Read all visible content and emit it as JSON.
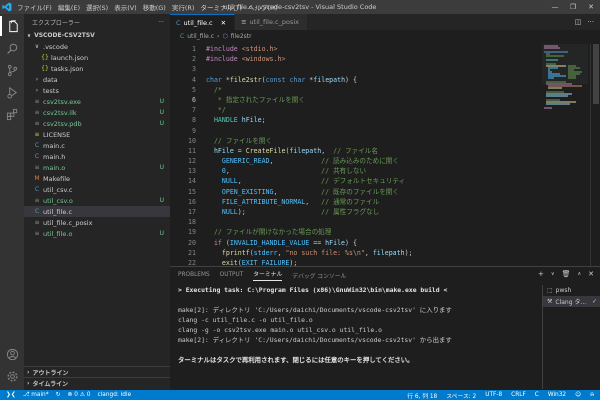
{
  "titlebar": {
    "menu": [
      "ファイル(F)",
      "編集(E)",
      "選択(S)",
      "表示(V)",
      "移動(G)",
      "実行(R)",
      "ターミナル(T)",
      "ヘルプ(H)"
    ],
    "title": "util_file.c - vscode-csv2tsv - Visual Studio Code"
  },
  "sidebar": {
    "header": "エクスプローラー",
    "more": "···",
    "folder": "VSCODE-CSV2TSV",
    "items": [
      {
        "label": ".vscode",
        "indent": 0,
        "type": "folder-open",
        "color": "#cccccc"
      },
      {
        "label": "launch.json",
        "indent": 1,
        "type": "json",
        "color": "#cccccc"
      },
      {
        "label": "tasks.json",
        "indent": 1,
        "type": "json",
        "color": "#cccccc"
      },
      {
        "label": "data",
        "indent": 0,
        "type": "folder",
        "color": "#cccccc"
      },
      {
        "label": "tests",
        "indent": 0,
        "type": "folder",
        "color": "#cccccc"
      },
      {
        "label": "csv2tsv.exe",
        "indent": 0,
        "type": "file",
        "color": "#73c991",
        "badge": "U"
      },
      {
        "label": "csv2tsv.ilk",
        "indent": 0,
        "type": "file",
        "color": "#73c991",
        "badge": "U"
      },
      {
        "label": "csv2tsv.pdb",
        "indent": 0,
        "type": "file",
        "color": "#73c991",
        "badge": "U"
      },
      {
        "label": "LICENSE",
        "indent": 0,
        "type": "license",
        "color": "#cccccc"
      },
      {
        "label": "main.c",
        "indent": 0,
        "type": "c",
        "color": "#cccccc"
      },
      {
        "label": "main.h",
        "indent": 0,
        "type": "h",
        "color": "#cccccc"
      },
      {
        "label": "main.o",
        "indent": 0,
        "type": "file",
        "color": "#73c991",
        "badge": "U"
      },
      {
        "label": "Makefile",
        "indent": 0,
        "type": "make",
        "color": "#cccccc"
      },
      {
        "label": "util_csv.c",
        "indent": 0,
        "type": "c",
        "color": "#cccccc"
      },
      {
        "label": "util_csv.o",
        "indent": 0,
        "type": "file",
        "color": "#73c991",
        "badge": "U"
      },
      {
        "label": "util_file.c",
        "indent": 0,
        "type": "c",
        "color": "#cccccc",
        "selected": true
      },
      {
        "label": "util_file.c_posix",
        "indent": 0,
        "type": "file",
        "color": "#cccccc"
      },
      {
        "label": "util_file.o",
        "indent": 0,
        "type": "file",
        "color": "#73c991",
        "badge": "U"
      }
    ],
    "outline": "アウトライン",
    "timeline": "タイムライン"
  },
  "editor": {
    "tabs": [
      {
        "label": "util_file.c",
        "active": true
      },
      {
        "label": "util_file.c_posix",
        "active": false
      }
    ],
    "breadcrumb": [
      "util_file.c",
      "file2str"
    ],
    "current_line": 6
  },
  "panel": {
    "tabs": [
      "PROBLEMS",
      "OUTPUT",
      "ターミナル",
      "デバッグ コンソール"
    ],
    "active_tab": 2,
    "terminal_lines": [
      {
        "text": "> Executing task: C:\\Program Files (x86)\\GnuWin32\\bin\\make.exe build <",
        "bold": true
      },
      {
        "text": "",
        "bold": false
      },
      {
        "text": "make[2]: ディレクトリ 'C:/Users/daichi/Documents/vscode-csv2tsv' に入ります",
        "bold": false
      },
      {
        "text": "clang -c util_file.c -o util_file.o",
        "bold": false
      },
      {
        "text": "clang -g -o csv2tsv.exe main.o util_csv.o util_file.o",
        "bold": false
      },
      {
        "text": "make[2]: ディレクトリ 'C:/Users/daichi/Documents/vscode-csv2tsv' から出ます",
        "bold": false
      },
      {
        "text": "",
        "bold": false
      },
      {
        "text": "ターミナルはタスクで再利用されます、閉じるには任意のキーを押してください。",
        "bold": true
      }
    ],
    "terminals": [
      {
        "label": "pwsh",
        "active": false
      },
      {
        "label": "Clang タ...",
        "active": true
      }
    ]
  },
  "statusbar": {
    "branch": "main*",
    "errors": "0",
    "warnings": "0",
    "clangd": "clangd: idle",
    "position": "行 6, 列 18",
    "spaces": "スペース: 2",
    "encoding": "UTF-8",
    "eol": "CRLF",
    "language": "C",
    "os": "Win32"
  },
  "colors": {
    "accent": "#007acc",
    "untracked": "#73c991",
    "sidebar_bg": "#252526",
    "editor_bg": "#1e1e1e"
  }
}
